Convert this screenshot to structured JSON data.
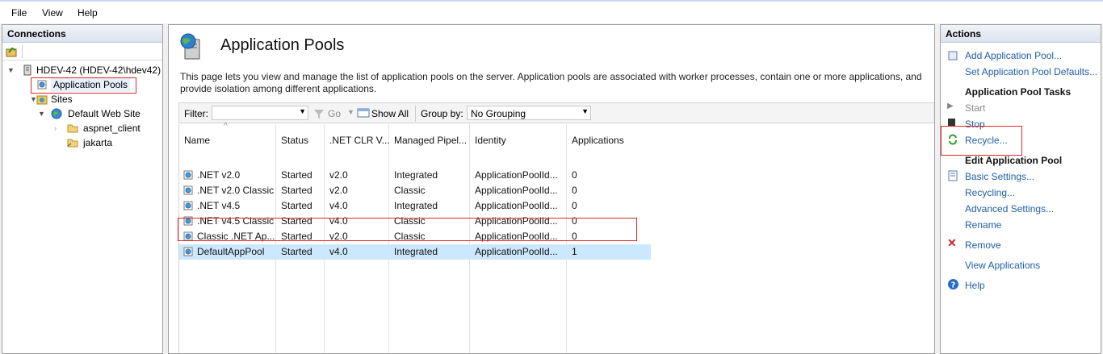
{
  "menu": {
    "file": "File",
    "view": "View",
    "help": "Help"
  },
  "connections": {
    "title": "Connections",
    "tree": [
      {
        "label": "HDEV-42 (HDEV-42\\hdev42)",
        "icon": "server-icon"
      },
      {
        "label": "Application Pools",
        "icon": "app-pool-icon"
      },
      {
        "label": "Sites",
        "icon": "sites-folder-icon"
      },
      {
        "label": "Default Web Site",
        "icon": "globe-icon"
      },
      {
        "label": "aspnet_client",
        "icon": "folder-icon"
      },
      {
        "label": "jakarta",
        "icon": "virtual-folder-icon"
      }
    ]
  },
  "main": {
    "title": "Application Pools",
    "description": "This page lets you view and manage the list of application pools on the server. Application pools are associated with worker processes, contain one or more applications, and provide isolation among different applications.",
    "filter": {
      "label": "Filter:",
      "value": "",
      "go": "Go",
      "show_all": "Show All",
      "group_by_label": "Group by:",
      "group_by_value": "No Grouping"
    },
    "columns": [
      "Name",
      "Status",
      ".NET CLR V...",
      "Managed Pipel...",
      "Identity",
      "Applications"
    ],
    "rows": [
      {
        "name": ".NET v2.0",
        "status": "Started",
        "clr": "v2.0",
        "pipeline": "Integrated",
        "identity": "ApplicationPoolId...",
        "apps": "0"
      },
      {
        "name": ".NET v2.0 Classic",
        "status": "Started",
        "clr": "v2.0",
        "pipeline": "Classic",
        "identity": "ApplicationPoolId...",
        "apps": "0"
      },
      {
        "name": ".NET v4.5",
        "status": "Started",
        "clr": "v4.0",
        "pipeline": "Integrated",
        "identity": "ApplicationPoolId...",
        "apps": "0"
      },
      {
        "name": ".NET v4.5 Classic",
        "status": "Started",
        "clr": "v4.0",
        "pipeline": "Classic",
        "identity": "ApplicationPoolId...",
        "apps": "0"
      },
      {
        "name": "Classic .NET Ap...",
        "status": "Started",
        "clr": "v2.0",
        "pipeline": "Classic",
        "identity": "ApplicationPoolId...",
        "apps": "0"
      },
      {
        "name": "DefaultAppPool",
        "status": "Started",
        "clr": "v4.0",
        "pipeline": "Integrated",
        "identity": "ApplicationPoolId...",
        "apps": "1"
      }
    ]
  },
  "actions": {
    "title": "Actions",
    "add_pool": "Add Application Pool...",
    "set_defaults": "Set Application Pool Defaults...",
    "tasks_heading": "Application Pool Tasks",
    "start": "Start",
    "stop": "Stop",
    "recycle": "Recycle...",
    "edit_heading": "Edit Application Pool",
    "basic_settings": "Basic Settings...",
    "recycling": "Recycling...",
    "advanced_settings": "Advanced Settings...",
    "rename": "Rename",
    "remove": "Remove",
    "view_applications": "View Applications",
    "help": "Help"
  },
  "colors": {
    "link": "#1f5fa8",
    "highlight_box": "#e0262a",
    "selected_row": "#cce8ff"
  }
}
